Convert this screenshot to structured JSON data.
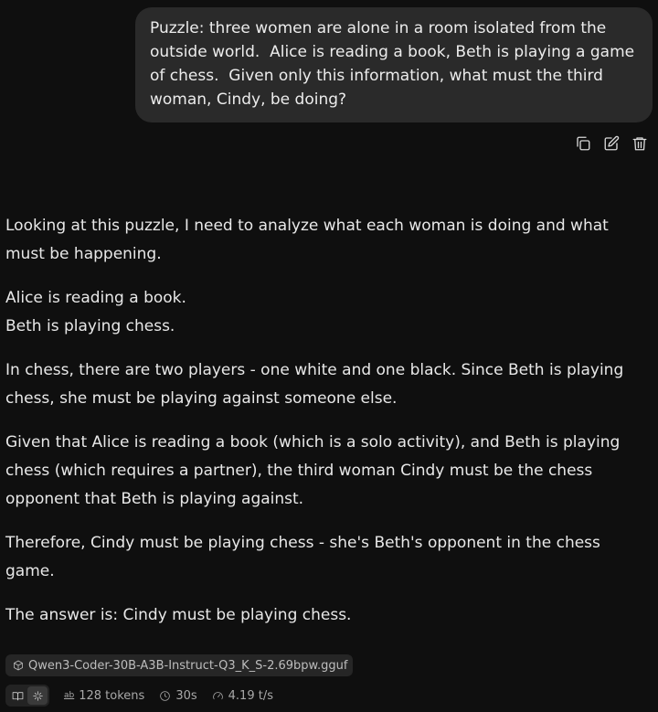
{
  "user_message": {
    "text": "Puzzle: three women are alone in a room isolated from the outside world.  Alice is reading a book, Beth is playing a game of chess.  Given only this information, what must the third woman, Cindy, be doing?"
  },
  "message_actions": {
    "icons": [
      "copy-icon",
      "edit-icon",
      "trash-icon"
    ]
  },
  "assistant_message": {
    "paragraphs": [
      "Looking at this puzzle, I need to analyze what each woman is doing and what must be happening.",
      "Alice is reading a book.",
      "Beth is playing chess.",
      "In chess, there are two players - one white and one black. Since Beth is playing chess, she must be playing against someone else.",
      "Given that Alice is reading a book (which is a solo activity), and Beth is playing chess (which requires a partner), the third woman Cindy must be the chess opponent that Beth is playing against.",
      "Therefore, Cindy must be playing chess - she's Beth's opponent in the chess game.",
      "The answer is: Cindy must be playing chess."
    ]
  },
  "model": {
    "name": "Qwen3-Coder-30B-A3B-Instruct-Q3_K_S-2.69bpw.gguf",
    "icon": "cube-icon"
  },
  "stats": {
    "tokens_icon_text": "ab",
    "tokens": "128 tokens",
    "time": "30s",
    "speed": "4.19 t/s"
  }
}
